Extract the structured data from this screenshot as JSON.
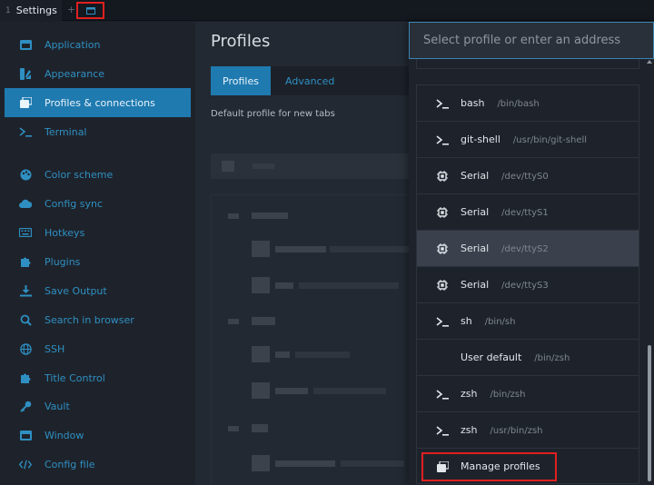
{
  "tabbar": {
    "tab_number": "1",
    "tab_title": "Settings",
    "add_tab": "+"
  },
  "sidebar": {
    "items": [
      {
        "label": "Application",
        "icon": "window-icon"
      },
      {
        "label": "Appearance",
        "icon": "palette-brush-icon"
      },
      {
        "label": "Profiles & connections",
        "icon": "profiles-icon"
      },
      {
        "label": "Terminal",
        "icon": "terminal-prompt-icon"
      },
      {
        "label": "Color scheme",
        "icon": "palette-icon"
      },
      {
        "label": "Config sync",
        "icon": "cloud-icon"
      },
      {
        "label": "Hotkeys",
        "icon": "keyboard-icon"
      },
      {
        "label": "Plugins",
        "icon": "puzzle-icon"
      },
      {
        "label": "Save Output",
        "icon": "download-icon"
      },
      {
        "label": "Search in browser",
        "icon": "search-icon"
      },
      {
        "label": "SSH",
        "icon": "globe-icon"
      },
      {
        "label": "Title Control",
        "icon": "puzzle-icon"
      },
      {
        "label": "Vault",
        "icon": "key-icon"
      },
      {
        "label": "Window",
        "icon": "window-icon"
      },
      {
        "label": "Config file",
        "icon": "code-icon"
      }
    ]
  },
  "main": {
    "title": "Profiles",
    "tabs": [
      {
        "label": "Profiles"
      },
      {
        "label": "Advanced"
      }
    ],
    "description": "Default profile for new tabs"
  },
  "dropdown": {
    "placeholder": "Select profile or enter an address",
    "items": [
      {
        "name": "bash",
        "path": "/bin/bash",
        "icon": "terminal-prompt-icon"
      },
      {
        "name": "git-shell",
        "path": "/usr/bin/git-shell",
        "icon": "terminal-prompt-icon"
      },
      {
        "name": "Serial",
        "path": "/dev/ttyS0",
        "icon": "chip-icon"
      },
      {
        "name": "Serial",
        "path": "/dev/ttyS1",
        "icon": "chip-icon"
      },
      {
        "name": "Serial",
        "path": "/dev/ttyS2",
        "icon": "chip-icon"
      },
      {
        "name": "Serial",
        "path": "/dev/ttyS3",
        "icon": "chip-icon"
      },
      {
        "name": "sh",
        "path": "/bin/sh",
        "icon": "terminal-prompt-icon"
      },
      {
        "name": "User default",
        "path": "/bin/zsh",
        "icon": ""
      },
      {
        "name": "zsh",
        "path": "/bin/zsh",
        "icon": "terminal-prompt-icon"
      },
      {
        "name": "zsh",
        "path": "/usr/bin/zsh",
        "icon": "terminal-prompt-icon"
      }
    ],
    "manage": {
      "label": "Manage profiles",
      "icon": "profiles-icon"
    }
  },
  "colors": {
    "accent": "#1f7ab0",
    "link": "#2f8fc2",
    "highlight_box": "#e02020"
  }
}
